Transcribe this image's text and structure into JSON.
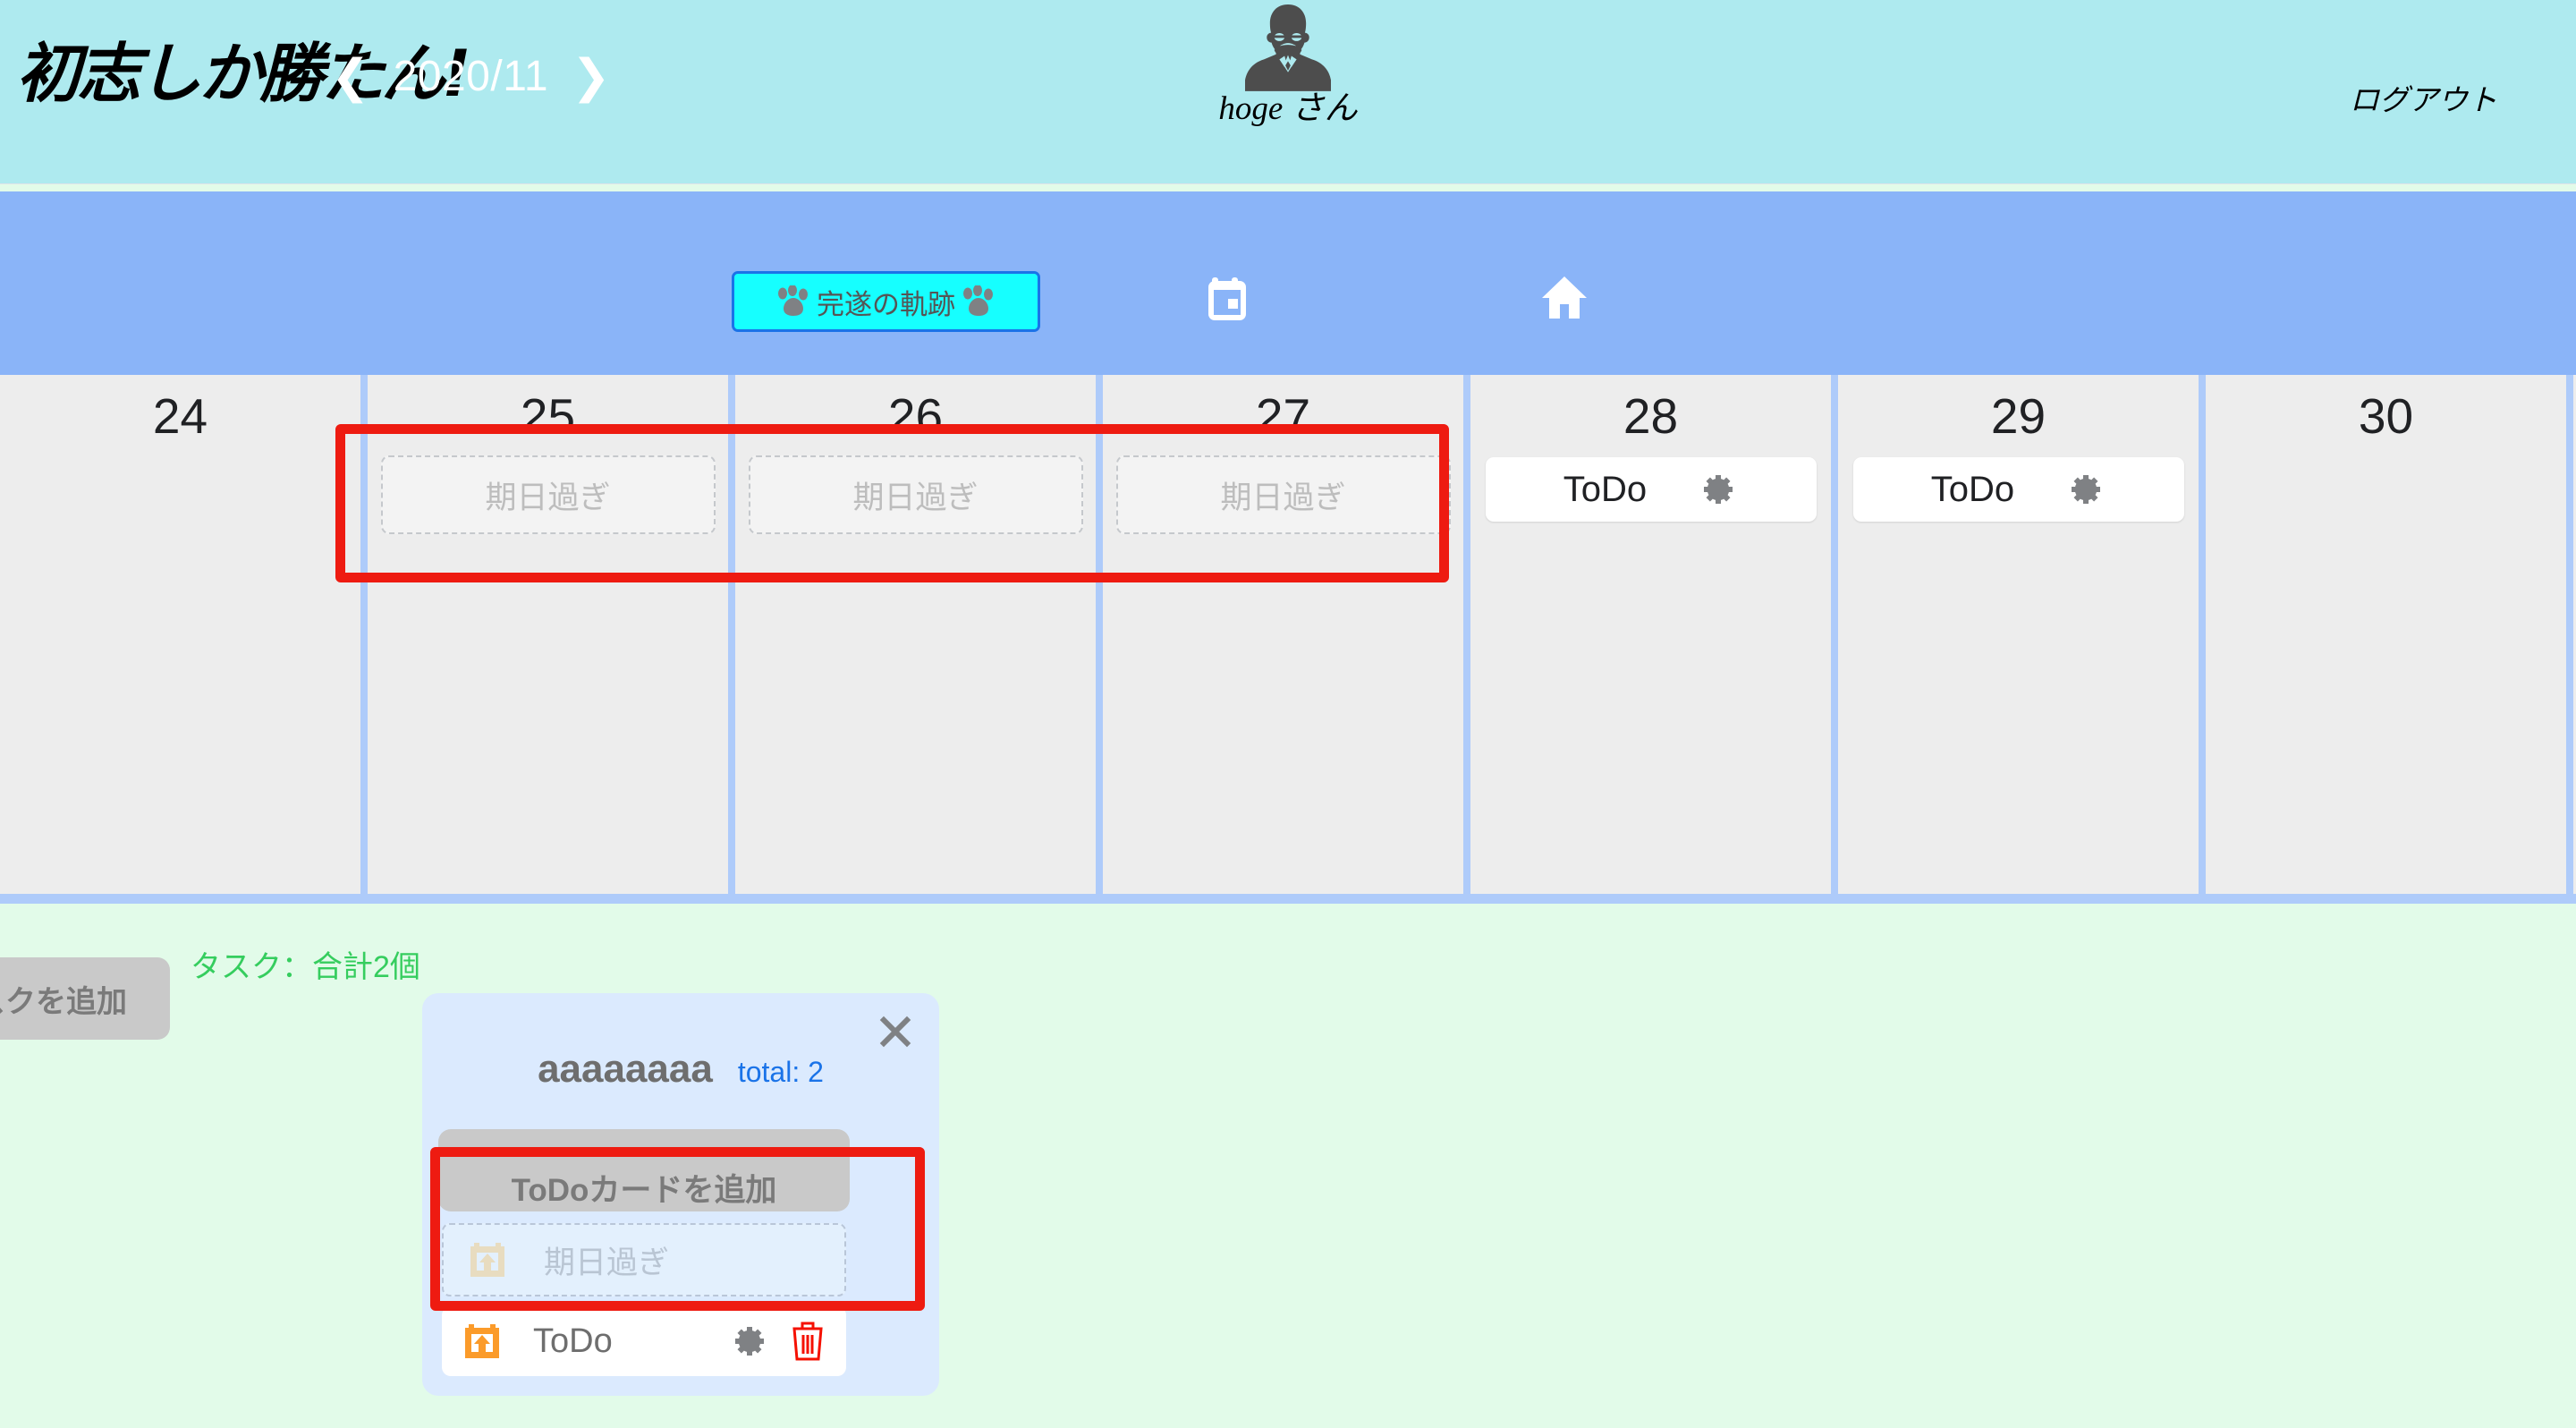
{
  "header": {
    "app_title": "初志しか勝たん!",
    "avatar_icon": "user-avatar-icon",
    "user_name": "hoge さん",
    "logout_label": "ログアウト"
  },
  "navbar": {
    "prev_icon": "❮",
    "next_icon": "❯",
    "month_label": "2020/11",
    "kiseki_label": "完遂の軌跡",
    "paw_icon": "paw-print-icon",
    "calendar_icon": "calendar-icon",
    "home_icon": "home-icon"
  },
  "calendar": {
    "days": [
      {
        "number": "24",
        "overdue": null,
        "todo": null
      },
      {
        "number": "25",
        "overdue": "期日過ぎ",
        "todo": null
      },
      {
        "number": "26",
        "overdue": "期日過ぎ",
        "todo": null
      },
      {
        "number": "27",
        "overdue": "期日過ぎ",
        "todo": null
      },
      {
        "number": "28",
        "overdue": null,
        "todo": "ToDo"
      },
      {
        "number": "29",
        "overdue": null,
        "todo": "ToDo"
      },
      {
        "number": "30",
        "overdue": null,
        "todo": null
      }
    ],
    "overdue_placeholder": "期日過ぎ",
    "todo_label": "ToDo",
    "gear_icon": "gear-icon"
  },
  "bottom": {
    "add_task_label": "タスクを追加",
    "task_count_label": "タスク：合計2個"
  },
  "task_panel": {
    "title": "aaaaaaaa",
    "total_label": "total: 2",
    "close_icon": "close-icon",
    "add_card_label": "ToDoカードを追加",
    "overdue_placeholder": "期日過ぎ",
    "overdue_icon": "calendar-upload-icon",
    "todo_label": "ToDo",
    "todo_icon": "calendar-upload-icon",
    "gear_icon": "gear-icon",
    "trash_icon": "trash-icon"
  },
  "annotations": {
    "calendar_highlight": "red-rectangle-calendar-overdue-slots",
    "panel_highlight": "red-rectangle-panel-overdue-slot"
  },
  "colors": {
    "header_bg": "#aeeaef",
    "navbar_bg": "#8ab4f8",
    "accent_cyan": "#16ffff",
    "accent_blue": "#1a73e8",
    "page_bg": "#e2fbe9",
    "panel_bg": "#dbeafe",
    "annotation_red": "#ee1b11",
    "count_green": "#35cd5e",
    "highlight_pink": "#ffadba"
  }
}
